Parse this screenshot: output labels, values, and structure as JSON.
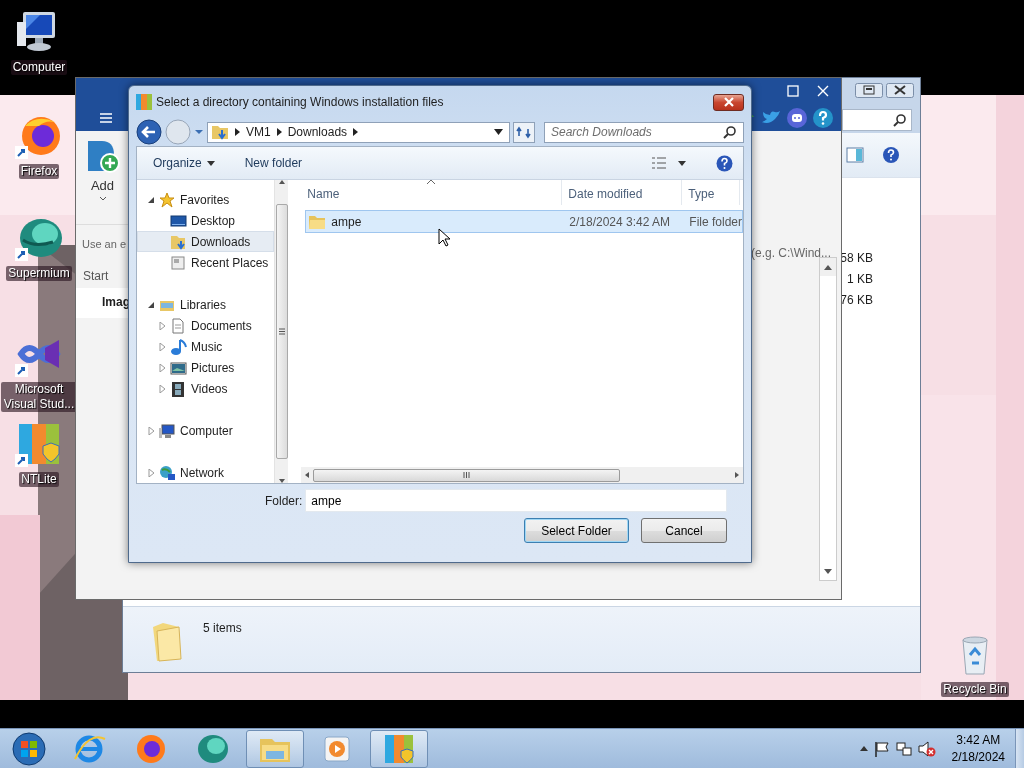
{
  "desktop_icons": [
    {
      "kind": "computer",
      "label": "Computer"
    },
    {
      "kind": "firefox",
      "label": "Firefox"
    },
    {
      "kind": "supermium",
      "label": "Supermium"
    },
    {
      "kind": "visual-studio",
      "label": "Microsoft Visual Stud..."
    },
    {
      "kind": "ntlite",
      "label": "NTLite"
    },
    {
      "kind": "recycle-bin",
      "label": "Recycle Bin"
    }
  ],
  "explorer_window": {
    "file_sizes": [
      "58 KB",
      "1 KB",
      "76 KB"
    ],
    "status": "5 items"
  },
  "ntlite_window": {
    "add_button": "Add",
    "hint": "Use an e",
    "tab": "Start",
    "row": "Imag",
    "path_hint": "(e.g. C:\\Wind..."
  },
  "dialog": {
    "title": "Select a directory containing Windows installation files",
    "breadcrumb": [
      "VM1",
      "Downloads"
    ],
    "search_placeholder": "Search Downloads",
    "toolbar": [
      "Organize",
      "New folder"
    ],
    "nav": [
      {
        "kind": "favorites",
        "label": "Favorites",
        "expanded": true,
        "selected": false,
        "children": [
          {
            "kind": "desktop",
            "label": "Desktop",
            "selected": false
          },
          {
            "kind": "downloads",
            "label": "Downloads",
            "selected": true
          },
          {
            "kind": "recent",
            "label": "Recent Places",
            "selected": false
          }
        ]
      },
      {
        "kind": "libraries",
        "label": "Libraries",
        "expanded": true,
        "selected": false,
        "children": [
          {
            "kind": "documents",
            "label": "Documents",
            "expanded": false,
            "selected": false
          },
          {
            "kind": "music",
            "label": "Music",
            "expanded": false,
            "selected": false
          },
          {
            "kind": "pictures",
            "label": "Pictures",
            "expanded": false,
            "selected": false
          },
          {
            "kind": "videos",
            "label": "Videos",
            "expanded": false,
            "selected": false
          }
        ]
      },
      {
        "kind": "computer",
        "label": "Computer",
        "expanded": false,
        "selected": false
      },
      {
        "kind": "network",
        "label": "Network",
        "expanded": false,
        "selected": false
      }
    ],
    "columns": [
      "Name",
      "Date modified",
      "Type"
    ],
    "rows": [
      {
        "name": "ampe",
        "date": "2/18/2024 3:42 AM",
        "type": "File folder",
        "selected": true
      }
    ],
    "folder_label": "Folder:",
    "folder_value": "ampe",
    "buttons": [
      {
        "label": "Select Folder",
        "default": true
      },
      {
        "label": "Cancel",
        "default": false
      }
    ]
  },
  "taskbar": {
    "items": [
      {
        "kind": "start",
        "running": false
      },
      {
        "kind": "internet-explorer",
        "running": false
      },
      {
        "kind": "firefox",
        "running": false
      },
      {
        "kind": "supermium",
        "running": false
      },
      {
        "kind": "file-explorer",
        "running": true
      },
      {
        "kind": "media-player",
        "running": false
      },
      {
        "kind": "ntlite",
        "running": true
      }
    ],
    "time": "3:42 AM",
    "date": "2/18/2024"
  }
}
